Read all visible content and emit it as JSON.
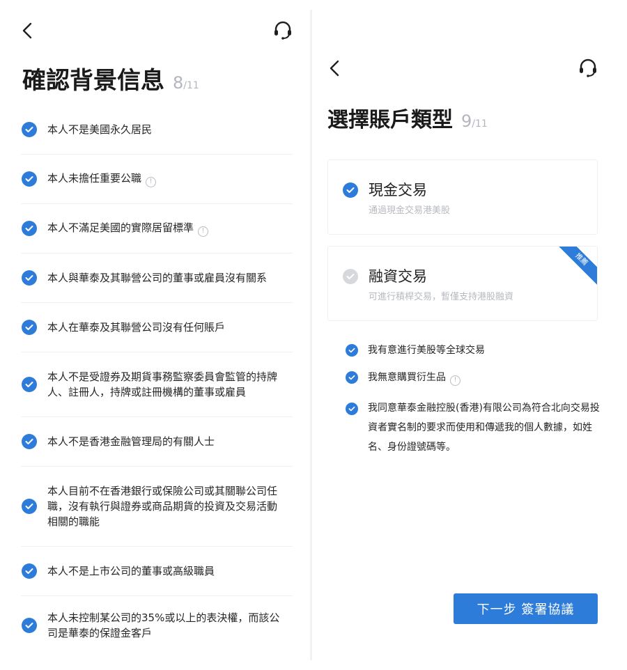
{
  "left_screen": {
    "title": "確認背景信息",
    "step_current": "8",
    "step_total": "/11",
    "items": [
      {
        "text": "本人不是美國永久居民",
        "info": false
      },
      {
        "text": "本人未擔任重要公職",
        "info": true
      },
      {
        "text": "本人不滿足美國的實際居留標準",
        "info": true
      },
      {
        "text": "本人與華泰及其聯營公司的董事或雇員沒有關系",
        "info": false
      },
      {
        "text": "本人在華泰及其聯營公司沒有任何賬戶",
        "info": false
      },
      {
        "text": "本人不是受證券及期貨事務監察委員會監管的持牌人、註冊人，持牌或註冊機構的董事或雇員",
        "info": false
      },
      {
        "text": "本人不是香港金融管理局的有關人士",
        "info": false
      },
      {
        "text": "本人目前不在香港銀行或保險公司或其關聯公司任職，沒有執行與證券或商品期貨的投資及交易活動相關的職能",
        "info": false
      },
      {
        "text": "本人不是上市公司的董事或高級職員",
        "info": false
      },
      {
        "text": "本人未控制某公司的35%或以上的表決權，而該公司是華泰的保證金客戶",
        "info": false
      }
    ],
    "icons": {
      "back": "back-arrow-icon",
      "support": "headset-icon",
      "check": "check-circle-icon"
    }
  },
  "right_screen": {
    "title": "選擇賬戶類型",
    "step_current": "9",
    "step_total": "/11",
    "cards": [
      {
        "title": "現金交易",
        "subtitle": "通過現金交易港美股",
        "selected": true,
        "badge": ""
      },
      {
        "title": "融資交易",
        "subtitle": "可進行積桿交易，暫僅支持港股融資",
        "selected": false,
        "badge": "推薦"
      }
    ],
    "agreements": [
      {
        "text": "我有意進行美股等全球交易",
        "info": false
      },
      {
        "text": "我無意購買衍生品",
        "info": true
      },
      {
        "text": "我同意華泰金融控股(香港)有限公司為符合北向交易投資者實名制的要求而使用和傳遞我的個人數據，如姓名、身份證號碼等。",
        "info": false
      }
    ],
    "next_button": "下一步 簽署協議"
  },
  "colors": {
    "accent": "#2d7cd9",
    "muted": "#b3b6bd",
    "text": "#262626"
  }
}
